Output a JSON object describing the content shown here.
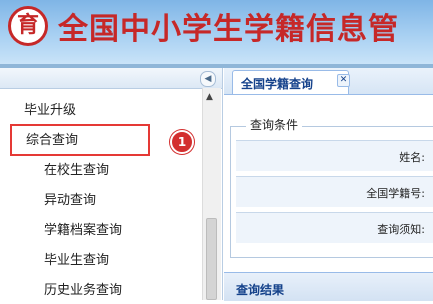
{
  "header": {
    "logo_glyph": "育",
    "title": "全国中小学生学籍信息管"
  },
  "sidebar": {
    "items": [
      {
        "label": "毕业升级",
        "indent": false
      },
      {
        "label": "综合查询",
        "indent": false
      },
      {
        "label": "在校生查询",
        "indent": true
      },
      {
        "label": "异动查询",
        "indent": true
      },
      {
        "label": "学籍档案查询",
        "indent": true
      },
      {
        "label": "毕业生查询",
        "indent": true
      },
      {
        "label": "历史业务查询",
        "indent": true
      }
    ],
    "badge": "1"
  },
  "main": {
    "tab_label": "全国学籍查询",
    "legend": "查询条件",
    "fields": [
      {
        "label": "姓名:"
      },
      {
        "label": "全国学籍号:"
      },
      {
        "label": "查询须知:"
      }
    ],
    "results_title": "查询结果"
  },
  "colors": {
    "title_red": "#c62828",
    "highlight": "#e53935",
    "tab_text": "#15428b"
  }
}
